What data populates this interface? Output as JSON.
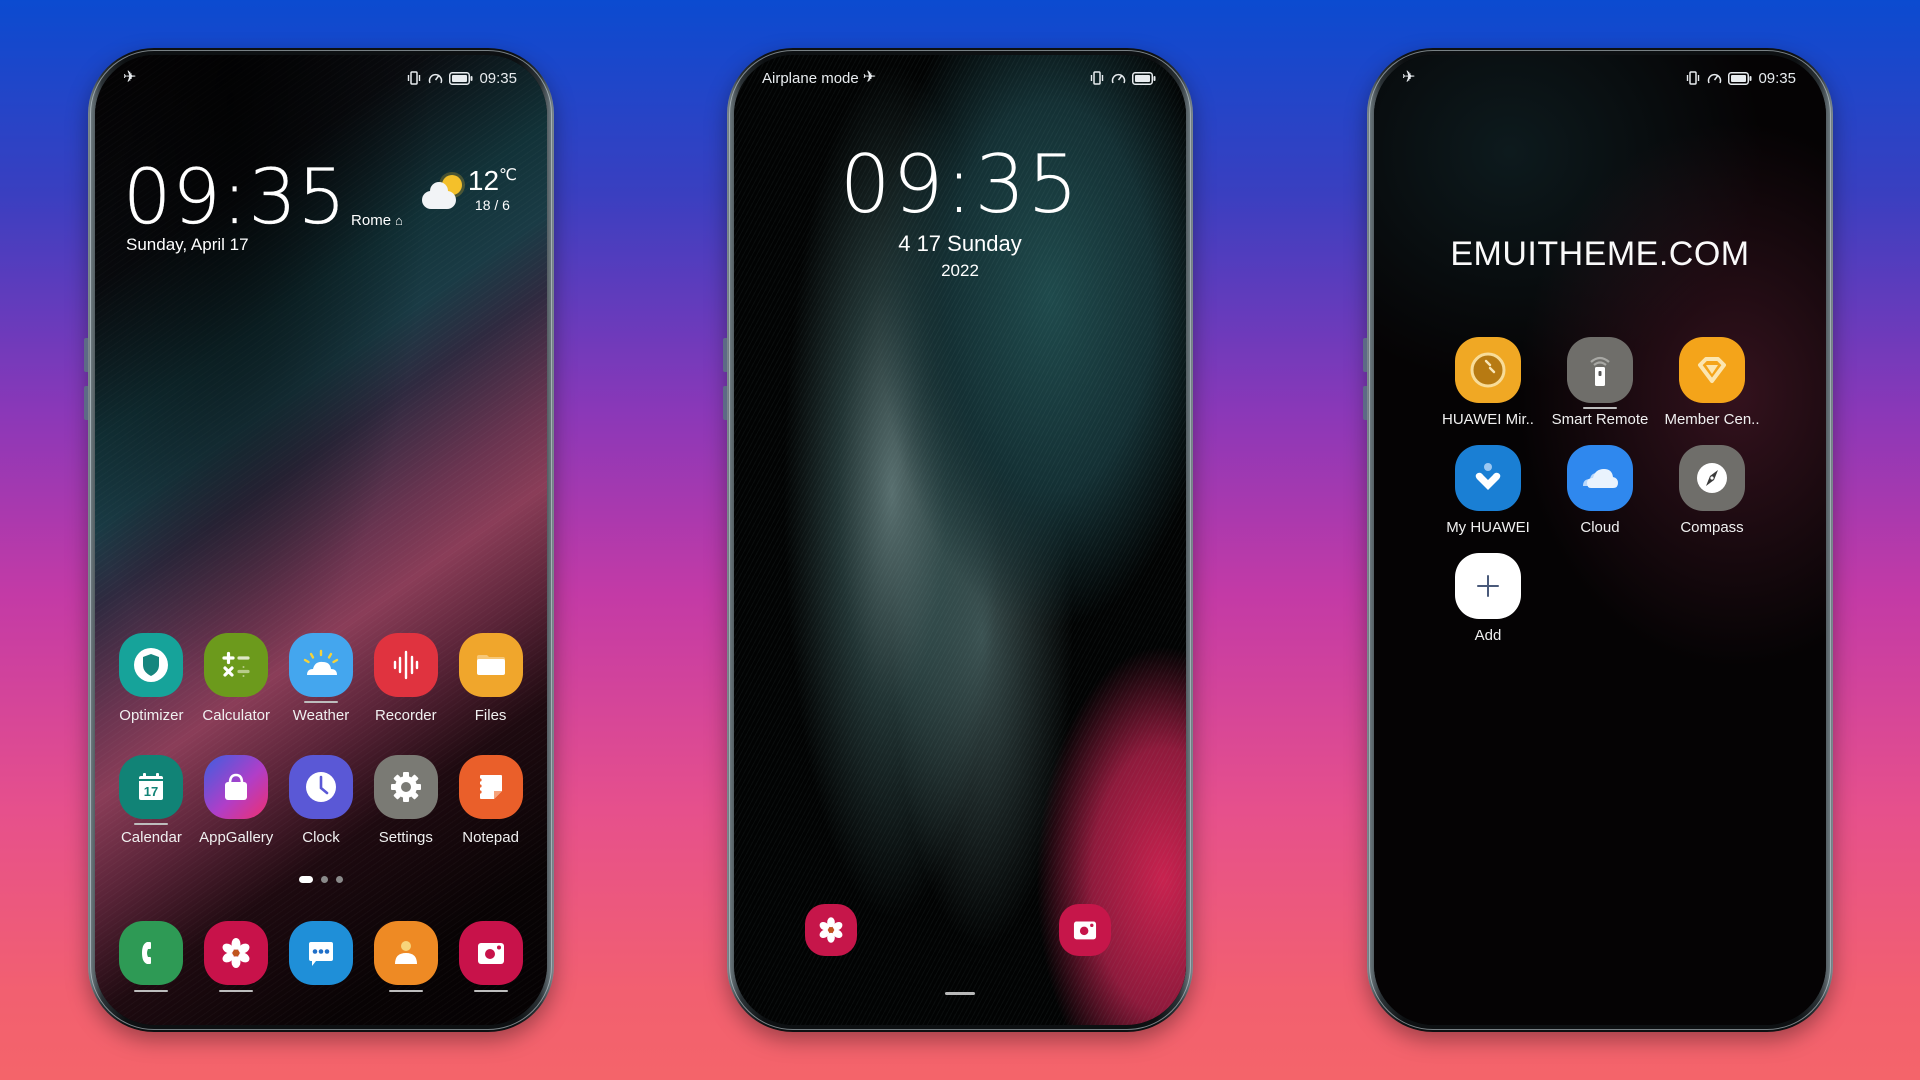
{
  "phones": {
    "home": {
      "status_bar": {
        "left_icon": "airplane-icon",
        "icons": [
          "vibrate-icon",
          "data-saver-icon",
          "battery-icon"
        ],
        "time": "09:35"
      },
      "clock_widget": {
        "time": "09:35",
        "city": "Rome",
        "city_icon": "home-icon",
        "date": "Sunday, April 17"
      },
      "weather_widget": {
        "icon": "partly-sunny-icon",
        "temperature": "12",
        "unit": "℃",
        "range": "18 / 6"
      },
      "apps_row_1": [
        {
          "label": "Optimizer",
          "icon": "shield-icon",
          "color": "#16a39a",
          "running": false
        },
        {
          "label": "Calculator",
          "icon": "calculator-icon",
          "color": "#6c9a1c",
          "running": false
        },
        {
          "label": "Weather",
          "icon": "weather-icon",
          "color": "#44a6ee",
          "running": true
        },
        {
          "label": "Recorder",
          "icon": "soundwave-icon",
          "color": "#e0333f",
          "running": false
        },
        {
          "label": "Files",
          "icon": "folder-icon",
          "color": "#f0a62c",
          "running": false
        }
      ],
      "apps_row_2": [
        {
          "label": "Calendar",
          "icon": "calendar-icon",
          "color": "#118376",
          "day": "17",
          "running": true
        },
        {
          "label": "AppGallery",
          "icon": "shopping-bag-icon",
          "color": "#8b3fd4",
          "running": false
        },
        {
          "label": "Clock",
          "icon": "clock-icon",
          "color": "#5a58d6",
          "running": true
        },
        {
          "label": "Settings",
          "icon": "gear-icon",
          "color": "#7a7a74",
          "running": false
        },
        {
          "label": "Notepad",
          "icon": "notepad-icon",
          "color": "#ea5f2a",
          "running": true
        }
      ],
      "page_indicator": {
        "count": 3,
        "active": 0
      },
      "dock": [
        {
          "name": "phone",
          "icon": "phone-icon",
          "color": "#2e9a55",
          "running": true
        },
        {
          "name": "gallery",
          "icon": "flower-icon",
          "color": "#c8124a",
          "running": true
        },
        {
          "name": "messages",
          "icon": "message-icon",
          "color": "#1f8fd8",
          "running": false
        },
        {
          "name": "contacts",
          "icon": "contact-icon",
          "color": "#ee8a24",
          "running": true
        },
        {
          "name": "camera",
          "icon": "camera-icon",
          "color": "#c8124a",
          "running": true
        }
      ]
    },
    "lock": {
      "status_bar": {
        "carrier_text": "Airplane mode",
        "left_icon": "airplane-icon",
        "icons": [
          "vibrate-icon",
          "data-saver-icon",
          "battery-icon"
        ]
      },
      "time": "09:35",
      "date": "4 17 Sunday",
      "year": "2022",
      "shortcuts": [
        {
          "name": "gallery",
          "icon": "flower-icon",
          "color": "#c6164a"
        },
        {
          "name": "camera",
          "icon": "camera-icon",
          "color": "#c6164a"
        }
      ]
    },
    "drawer": {
      "status_bar": {
        "left_icon": "airplane-icon",
        "icons": [
          "vibrate-icon",
          "data-saver-icon",
          "battery-icon"
        ],
        "time": "09:35"
      },
      "folder_title": "EMUITHEME.COM",
      "apps": [
        {
          "label": "HUAWEI Mir..",
          "icon": "mirror-icon",
          "color": "#f0a824",
          "running": false
        },
        {
          "label": "Smart Remote",
          "icon": "remote-icon",
          "color": "#6f6e6a",
          "running": true
        },
        {
          "label": "Member Cen..",
          "icon": "diamond-icon",
          "color": "#f4a41a",
          "running": false
        },
        {
          "label": "My HUAWEI",
          "icon": "heart-person-icon",
          "color": "#1a7fd4",
          "running": false
        },
        {
          "label": "Cloud",
          "icon": "cloud-icon",
          "color": "#2f88ee",
          "running": false
        },
        {
          "label": "Compass",
          "icon": "compass-icon",
          "color": "#6f6e6a",
          "running": false
        },
        {
          "label": "Add",
          "icon": "plus-icon",
          "color": "#ffffff",
          "running": false
        }
      ]
    }
  }
}
